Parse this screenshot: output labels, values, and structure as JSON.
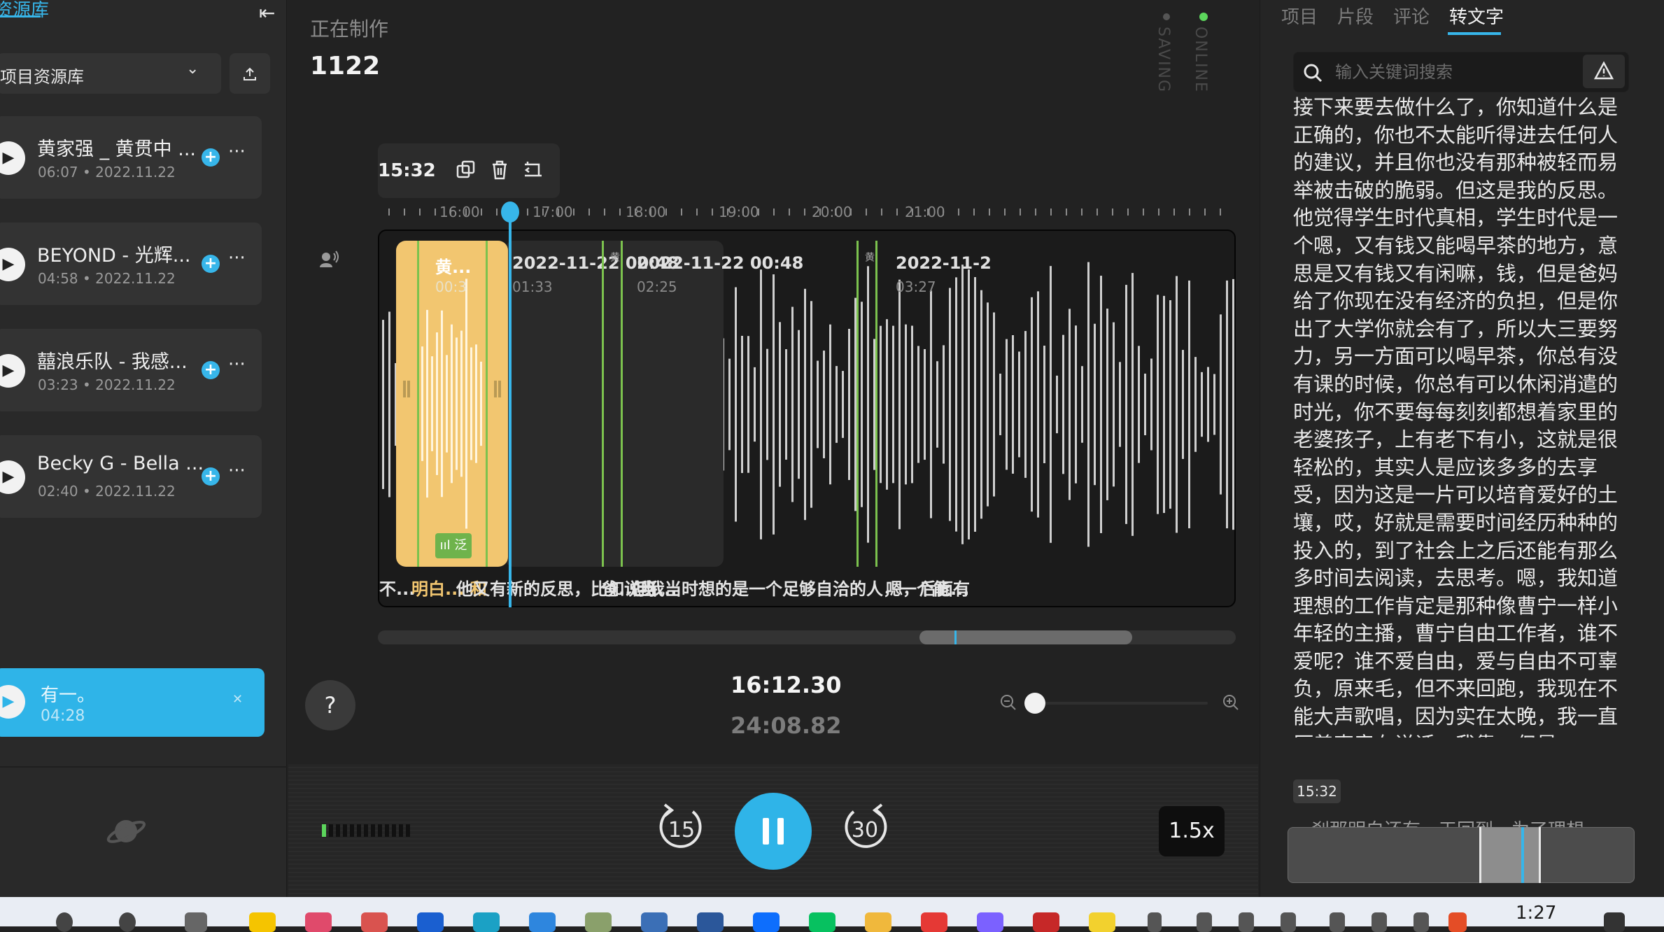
{
  "sidebar": {
    "title": "资源库",
    "library_select": "项目资源库",
    "tracks": [
      {
        "title": "黄家强 _ 黄贯中 ...",
        "duration": "06:07",
        "date": "2022.11.22"
      },
      {
        "title": "BEYOND - 光辉...",
        "duration": "04:58",
        "date": "2022.11.22"
      },
      {
        "title": "囍浪乐队 - 我感...",
        "duration": "03:23",
        "date": "2022.11.22"
      },
      {
        "title": "Becky G - Bella ...",
        "duration": "02:40",
        "date": "2022.11.22"
      }
    ],
    "now_playing": {
      "title": "有一。",
      "duration": "04:28"
    }
  },
  "header": {
    "status_label": "正在制作",
    "project_name": "1122",
    "saving": "SAVING",
    "online": "ONLINE"
  },
  "timeline": {
    "segment_time": "15:32",
    "ruler_labels": [
      "16:00",
      "17:00",
      "18:00",
      "19:00",
      "20:00",
      "21:00"
    ],
    "clips": [
      {
        "title": "2022-11-22 00:48",
        "duration": "01:33"
      },
      {
        "title": "2022-11-22 00:48",
        "duration": "02:25"
      },
      {
        "title": "2022-11-2",
        "duration": "03:27"
      }
    ],
    "selected_clip": {
      "title": "黄...",
      "duration": "00:3",
      "badge": "ııl 泛"
    },
    "small_clip_labels": [
      "黄",
      "黄"
    ],
    "transcript_snippets": [
      {
        "text": "不..."
      },
      {
        "text": "明白... 和"
      },
      {
        "text": "他又有新的反思，比如说当..."
      },
      {
        "text": "爸...我"
      },
      {
        "text": "但我当时想的是一个足够自洽的人，一个能..."
      },
      {
        "text": "嗯，后面有"
      }
    ]
  },
  "transport": {
    "current_time": "16:12.30",
    "total_time": "24:08.82",
    "rewind_label": "15",
    "forward_label": "30",
    "speed": "1.5x",
    "help": "?",
    "progress_fraction": 0.67
  },
  "right_panel": {
    "tabs": [
      "项目",
      "片段",
      "评论",
      "转文字"
    ],
    "active_tab": "转文字",
    "search_placeholder": "输入关键词搜索",
    "transcript_text": "接下来要去做什么了，你知道什么是正确的，你也不太能听得进去任何人的建议，并且你也没有那种被轻而易举被击破的脆弱。但这是我的反思。他觉得学生时代真相，学生时代是一个嗯，又有钱又能喝早茶的地方，意思是又有钱又有闲嘛，钱，但是爸妈给了你现在没有经济的负担，但是你出了大学你就会有了，所以大三要努力，另一方面可以喝早茶，你总有没有课的时候，你总有可以休闲消遣的时光，你不要每每刻刻都想着家里的老婆孩子，上有老下有小，这就是很轻松的，其实人是应该多多的去享受，因为这是一片可以培育爱好的土壤，哎，好就是需要时间经历种种的投入的，到了社会上之后还能有那么多时间去阅读，去思考。嗯，我知道理想的工作肯定是那种像曹宁一样小年轻的主播，曹宁自由工作者，谁不爱呢？谁不爱自由，爱与自由不可辜负，原来毛，但不来回跑，我现在不能大声歌唱，因为实在太晚，我一直压着声音在说话，我靠，但是",
    "next_timestamp": "15:32",
    "next_text": "一刹那明白还有一天回到，为了理想"
  },
  "taskbar": {
    "clock": "1:27"
  },
  "colors": {
    "accent": "#37b6ea",
    "selected_clip": "#f2c670",
    "online": "#5cd65c",
    "marker_green": "#7cc24e"
  }
}
